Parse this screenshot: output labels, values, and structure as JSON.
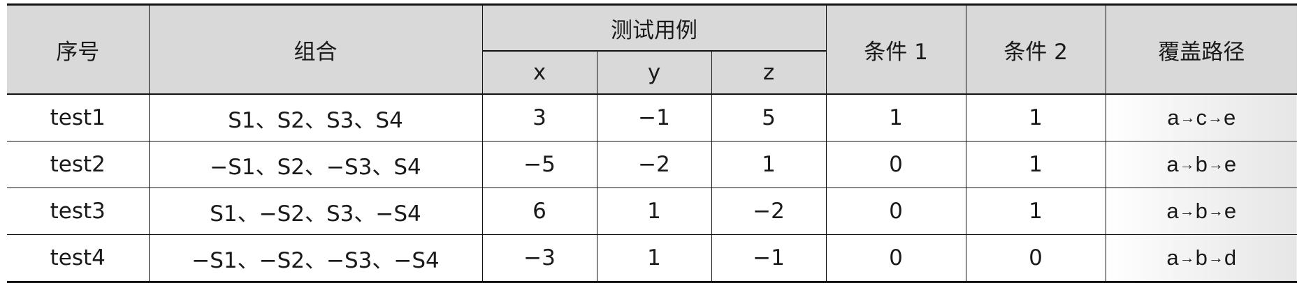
{
  "headers": {
    "index": "序号",
    "combination": "组合",
    "test_case": "测试用例",
    "x": "x",
    "y": "y",
    "z": "z",
    "cond1": "条件 1",
    "cond2": "条件 2",
    "path": "覆盖路径"
  },
  "rows": [
    {
      "index": "test1",
      "combination": "S1、S2、S3、S4",
      "x": "3",
      "y": "−1",
      "z": "5",
      "cond1": "1",
      "cond2": "1",
      "path": [
        "a",
        "c",
        "e"
      ]
    },
    {
      "index": "test2",
      "combination": "−S1、S2、−S3、S4",
      "x": "−5",
      "y": "−2",
      "z": "1",
      "cond1": "0",
      "cond2": "1",
      "path": [
        "a",
        "b",
        "e"
      ]
    },
    {
      "index": "test3",
      "combination": "S1、−S2、S3、−S4",
      "x": "6",
      "y": "1",
      "z": "−2",
      "cond1": "0",
      "cond2": "1",
      "path": [
        "a",
        "b",
        "e"
      ]
    },
    {
      "index": "test4",
      "combination": "−S1、−S2、−S3、−S4",
      "x": "−3",
      "y": "1",
      "z": "−1",
      "cond1": "0",
      "cond2": "0",
      "path": [
        "a",
        "b",
        "d"
      ]
    }
  ],
  "arrow_symbol": "→"
}
